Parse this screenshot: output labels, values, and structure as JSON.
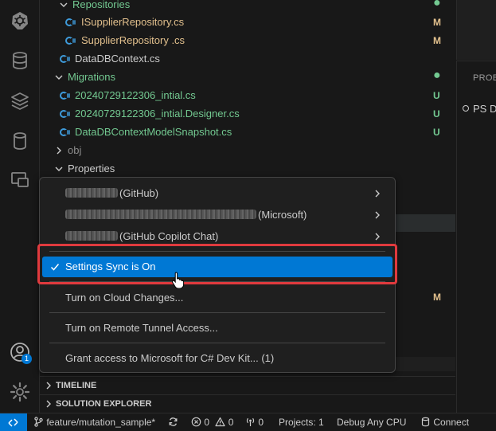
{
  "explorer": {
    "rows": [
      {
        "label": "Repositories",
        "status": "",
        "dot": true,
        "color": "#73c991"
      },
      {
        "label": "ISupplierRepository.cs",
        "status": "M",
        "color": "#e2c08d"
      },
      {
        "label": "SupplierRepository .cs",
        "status": "M",
        "color": "#e2c08d"
      },
      {
        "label": "DataDBContext.cs",
        "status": "",
        "color": "#cccccc"
      },
      {
        "label": "Migrations",
        "status": "",
        "dot": true,
        "color": "#73c991"
      },
      {
        "label": "20240729122306_intial.cs",
        "status": "U",
        "color": "#73c991"
      },
      {
        "label": "20240729122306_intial.Designer.cs",
        "status": "U",
        "color": "#73c991"
      },
      {
        "label": "DataDBContextModelSnapshot.cs",
        "status": "U",
        "color": "#73c991"
      },
      {
        "label": "obj",
        "status": "",
        "color": "#8b8b8b"
      },
      {
        "label": "Properties",
        "status": "",
        "color": "#cccccc"
      }
    ],
    "hidden_row_status": "M"
  },
  "panel": {
    "tab_label": "PROB",
    "terminal_text": "PS  D"
  },
  "sections": {
    "timeline": "TIMELINE",
    "solution_explorer": "SOLUTION EXPLORER"
  },
  "accounts_menu": {
    "items": [
      {
        "label": "(GitHub)",
        "has_submenu": true
      },
      {
        "label": "(Microsoft)",
        "has_submenu": true
      },
      {
        "label": "(GitHub Copilot Chat)",
        "has_submenu": true
      }
    ],
    "settings_sync": "Settings Sync is On",
    "cloud_changes": "Turn on Cloud Changes...",
    "remote_tunnel": "Turn on Remote Tunnel Access...",
    "grant_access": "Grant access to Microsoft for C# Dev Kit... (1)"
  },
  "activity_bar": {
    "account_badge": "1"
  },
  "statusbar": {
    "branch": "feature/mutation_sample*",
    "errors": "0",
    "warnings": "0",
    "ports": "0",
    "projects": "Projects: 1",
    "debug": "Debug Any CPU",
    "connect": "Connect"
  },
  "colors": {
    "accent": "#0078d4",
    "highlight_box": "#e03a3e",
    "added": "#73c991",
    "modified": "#e2c08d"
  }
}
